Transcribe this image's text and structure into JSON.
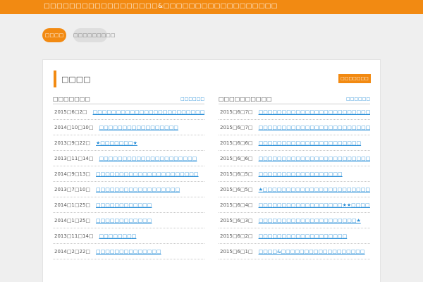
{
  "header": {
    "title": "□□□□□□□□□□□□□□□□□□&□□□□□□□□□□□□□□□□□□"
  },
  "tabs": [
    {
      "label": "□□□□"
    },
    {
      "label": "□□□□□□□□□"
    }
  ],
  "panel": {
    "title": "□□□□",
    "button_label": "□□□□□□□"
  },
  "left_column": {
    "title": "□□□□□□□",
    "more_label": "□□□□□□",
    "items": [
      {
        "date": "2015□6□2□",
        "text": "□□□□□□□□□□□□□□□□□□□□□□□□□□□□..."
      },
      {
        "date": "2014□10□10□",
        "text": "□□□□□□□□□□□□□□□□□"
      },
      {
        "date": "2013□9□22□",
        "text": "★□□□□□□□★"
      },
      {
        "date": "2013□11□14□",
        "text": "□□□□□□□□□□□□□□□□□□□□□"
      },
      {
        "date": "2014□9□13□",
        "text": "□□□□□□□□□□□□□□□□□□□□□□"
      },
      {
        "date": "2013□7□10□",
        "text": "□□□□□□□□□□□□□□□□□□"
      },
      {
        "date": "2014□1□25□",
        "text": "□□□□□□□□□□□□"
      },
      {
        "date": "2014□1□25□",
        "text": "□□□□□□□□□□□□"
      },
      {
        "date": "2013□11□14□",
        "text": "□□□□□□□□"
      },
      {
        "date": "2014□2□22□",
        "text": "□□□□□□□□□□□□□□"
      }
    ]
  },
  "right_column": {
    "title": "□□□□□□□□□□",
    "more_label": "□□□□□□",
    "items": [
      {
        "date": "2015□6□7□",
        "text": "□□□□□□□□□□□□□□□□□□□□□□□□□□□□"
      },
      {
        "date": "2015□6□7□",
        "text": "□□□□□□□□□□□□□□□□□□□□□□□□"
      },
      {
        "date": "2015□6□6□",
        "text": "□□□□□□□□□□□□□□□□□□□□□□"
      },
      {
        "date": "2015□6□6□",
        "text": "□□□□□□□□□□□□□□□□□□□□□□□□□"
      },
      {
        "date": "2015□6□5□",
        "text": "□□□□□□□□□□□□□□□□□□"
      },
      {
        "date": "2015□6□5□",
        "text": "★□□□□□□□□□□□□□□□□□□□□□□□★"
      },
      {
        "date": "2015□6□4□",
        "text": "□□□□□□□□□□□□□□□□□□★★□□□□..."
      },
      {
        "date": "2015□6□3□",
        "text": "□□□□□□□□□□□□□□□□□□□□□★"
      },
      {
        "date": "2015□6□2□",
        "text": "□□□□□□□□□□□□□□□□□□□"
      },
      {
        "date": "2015□6□1□",
        "text": "□□□□&□□□□□□□□□□□□□□□□□□"
      }
    ]
  },
  "colors": {
    "accent": "#f28a12",
    "link": "#2a8fd8",
    "background": "#efefef"
  }
}
